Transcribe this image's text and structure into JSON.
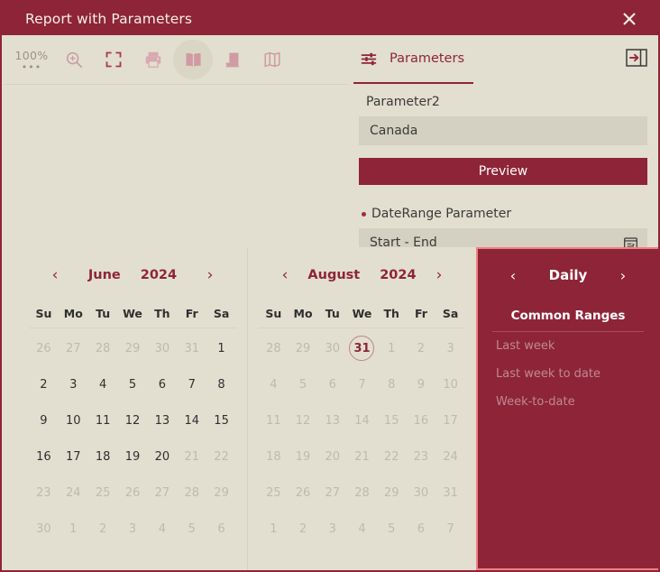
{
  "window": {
    "title": "Report with Parameters",
    "close_label": "✕"
  },
  "toolbar": {
    "zoom_level": "100%",
    "zoom_more": "•••",
    "icons": [
      {
        "name": "zoom-in-icon",
        "label": "Zoom In"
      },
      {
        "name": "fit-page-icon",
        "label": "Fit to Page"
      },
      {
        "name": "print-icon",
        "label": "Print"
      },
      {
        "name": "two-page-view-icon",
        "label": "Two Page View"
      },
      {
        "name": "single-page-view-icon",
        "label": "Single Page View"
      },
      {
        "name": "multi-page-view-icon",
        "label": "Multi Page View"
      }
    ],
    "parameters_tab": "Parameters",
    "collapse_panel_label": "Collapse Panel"
  },
  "parameters": {
    "param2_label": "Parameter2",
    "param2_value": "Canada",
    "preview_button": "Preview",
    "daterange_label": "DateRange Parameter",
    "daterange_value": "Start - End"
  },
  "daterange_picker": {
    "calendars": [
      {
        "month": "June",
        "year": "2024",
        "prev": "‹",
        "next": "›",
        "dow": [
          "Su",
          "Mo",
          "Tu",
          "We",
          "Th",
          "Fr",
          "Sa"
        ],
        "days": [
          {
            "d": "26",
            "state": "muted"
          },
          {
            "d": "27",
            "state": "muted"
          },
          {
            "d": "28",
            "state": "muted"
          },
          {
            "d": "29",
            "state": "muted"
          },
          {
            "d": "30",
            "state": "muted"
          },
          {
            "d": "31",
            "state": "muted"
          },
          {
            "d": "1",
            "state": "normal"
          },
          {
            "d": "2",
            "state": "normal"
          },
          {
            "d": "3",
            "state": "normal"
          },
          {
            "d": "4",
            "state": "normal"
          },
          {
            "d": "5",
            "state": "normal"
          },
          {
            "d": "6",
            "state": "normal"
          },
          {
            "d": "7",
            "state": "normal"
          },
          {
            "d": "8",
            "state": "normal"
          },
          {
            "d": "9",
            "state": "normal"
          },
          {
            "d": "10",
            "state": "normal"
          },
          {
            "d": "11",
            "state": "normal"
          },
          {
            "d": "12",
            "state": "normal"
          },
          {
            "d": "13",
            "state": "normal"
          },
          {
            "d": "14",
            "state": "normal"
          },
          {
            "d": "15",
            "state": "normal"
          },
          {
            "d": "16",
            "state": "normal"
          },
          {
            "d": "17",
            "state": "normal"
          },
          {
            "d": "18",
            "state": "normal"
          },
          {
            "d": "19",
            "state": "normal"
          },
          {
            "d": "20",
            "state": "normal"
          },
          {
            "d": "21",
            "state": "muted"
          },
          {
            "d": "22",
            "state": "muted"
          },
          {
            "d": "23",
            "state": "muted"
          },
          {
            "d": "24",
            "state": "muted"
          },
          {
            "d": "25",
            "state": "muted"
          },
          {
            "d": "26",
            "state": "muted"
          },
          {
            "d": "27",
            "state": "muted"
          },
          {
            "d": "28",
            "state": "muted"
          },
          {
            "d": "29",
            "state": "muted"
          },
          {
            "d": "30",
            "state": "muted"
          },
          {
            "d": "1",
            "state": "muted"
          },
          {
            "d": "2",
            "state": "muted"
          },
          {
            "d": "3",
            "state": "muted"
          },
          {
            "d": "4",
            "state": "muted"
          },
          {
            "d": "5",
            "state": "muted"
          },
          {
            "d": "6",
            "state": "muted"
          }
        ]
      },
      {
        "month": "August",
        "year": "2024",
        "prev": "‹",
        "next": "›",
        "dow": [
          "Su",
          "Mo",
          "Tu",
          "We",
          "Th",
          "Fr",
          "Sa"
        ],
        "days": [
          {
            "d": "28",
            "state": "muted"
          },
          {
            "d": "29",
            "state": "muted"
          },
          {
            "d": "30",
            "state": "muted"
          },
          {
            "d": "31",
            "state": "circled"
          },
          {
            "d": "1",
            "state": "muted"
          },
          {
            "d": "2",
            "state": "muted"
          },
          {
            "d": "3",
            "state": "muted"
          },
          {
            "d": "4",
            "state": "muted"
          },
          {
            "d": "5",
            "state": "muted"
          },
          {
            "d": "6",
            "state": "muted"
          },
          {
            "d": "7",
            "state": "muted"
          },
          {
            "d": "8",
            "state": "muted"
          },
          {
            "d": "9",
            "state": "muted"
          },
          {
            "d": "10",
            "state": "muted"
          },
          {
            "d": "11",
            "state": "muted"
          },
          {
            "d": "12",
            "state": "muted"
          },
          {
            "d": "13",
            "state": "muted"
          },
          {
            "d": "14",
            "state": "muted"
          },
          {
            "d": "15",
            "state": "muted"
          },
          {
            "d": "16",
            "state": "muted"
          },
          {
            "d": "17",
            "state": "muted"
          },
          {
            "d": "18",
            "state": "muted"
          },
          {
            "d": "19",
            "state": "muted"
          },
          {
            "d": "20",
            "state": "muted"
          },
          {
            "d": "21",
            "state": "muted"
          },
          {
            "d": "22",
            "state": "muted"
          },
          {
            "d": "23",
            "state": "muted"
          },
          {
            "d": "24",
            "state": "muted"
          },
          {
            "d": "25",
            "state": "muted"
          },
          {
            "d": "26",
            "state": "muted"
          },
          {
            "d": "27",
            "state": "muted"
          },
          {
            "d": "28",
            "state": "muted"
          },
          {
            "d": "29",
            "state": "muted"
          },
          {
            "d": "30",
            "state": "muted"
          },
          {
            "d": "31",
            "state": "muted"
          },
          {
            "d": "1",
            "state": "muted"
          },
          {
            "d": "2",
            "state": "muted"
          },
          {
            "d": "3",
            "state": "muted"
          },
          {
            "d": "4",
            "state": "muted"
          },
          {
            "d": "5",
            "state": "muted"
          },
          {
            "d": "6",
            "state": "muted"
          },
          {
            "d": "7",
            "state": "muted"
          }
        ]
      }
    ],
    "ranges_panel": {
      "title": "Daily",
      "prev": "‹",
      "next": "›",
      "subtitle": "Common Ranges",
      "items": [
        "Last week",
        "Last week to date",
        "Week-to-date"
      ]
    }
  },
  "colors": {
    "brand": "#8E2438",
    "panel_bg": "#E2DFD0",
    "input_bg": "#D4D1C2",
    "highlight_border": "#F08080",
    "muted_text": "#BFBBAC"
  }
}
